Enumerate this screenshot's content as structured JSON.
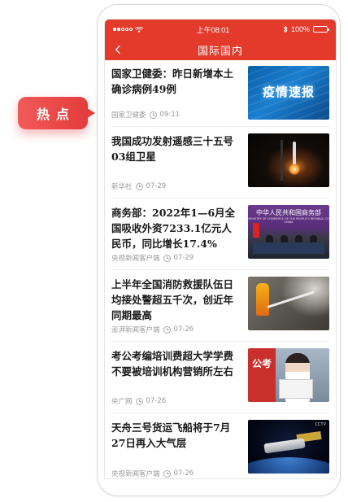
{
  "status_bar": {
    "time": "上午08:01",
    "battery": "100%",
    "battery_level": 1.0
  },
  "nav": {
    "title": "国际国内",
    "back_icon": "chevron-left-icon"
  },
  "badge": {
    "label": "热点"
  },
  "articles": [
    {
      "title": "国家卫健委：昨日新增本土确诊病例49例",
      "source": "国家卫健委",
      "time": "09:11",
      "thumb_text": "疫情速报"
    },
    {
      "title": "我国成功发射遥感三十五号03组卫星",
      "source": "新华社",
      "time": "07-29"
    },
    {
      "title": "商务部：2022年1—6月全国吸收外资7233.1亿元人民币，同比增长17.4%",
      "source": "央视新闻客户端",
      "time": "07-29",
      "thumb_text": "中华人民共和国商务部",
      "thumb_subtext": "MINISTRY OF COMMERCE OF THE PEOPLE'S REPUBLIC OF CHINA"
    },
    {
      "title": "上半年全国消防救援队伍日均接处警超五千次，创近年同期最高",
      "source": "澎湃新闻客户端",
      "time": "07-26"
    },
    {
      "title": "考公考编培训费超大学学费 不要被培训机构营销所左右",
      "source": "央广网",
      "time": "07-26",
      "thumb_text": "公考"
    },
    {
      "title": "天舟三号货运飞船将于7月27日再入大气层",
      "source": "央视新闻客户端",
      "time": "07-26",
      "thumb_text": "CCTV"
    }
  ]
}
